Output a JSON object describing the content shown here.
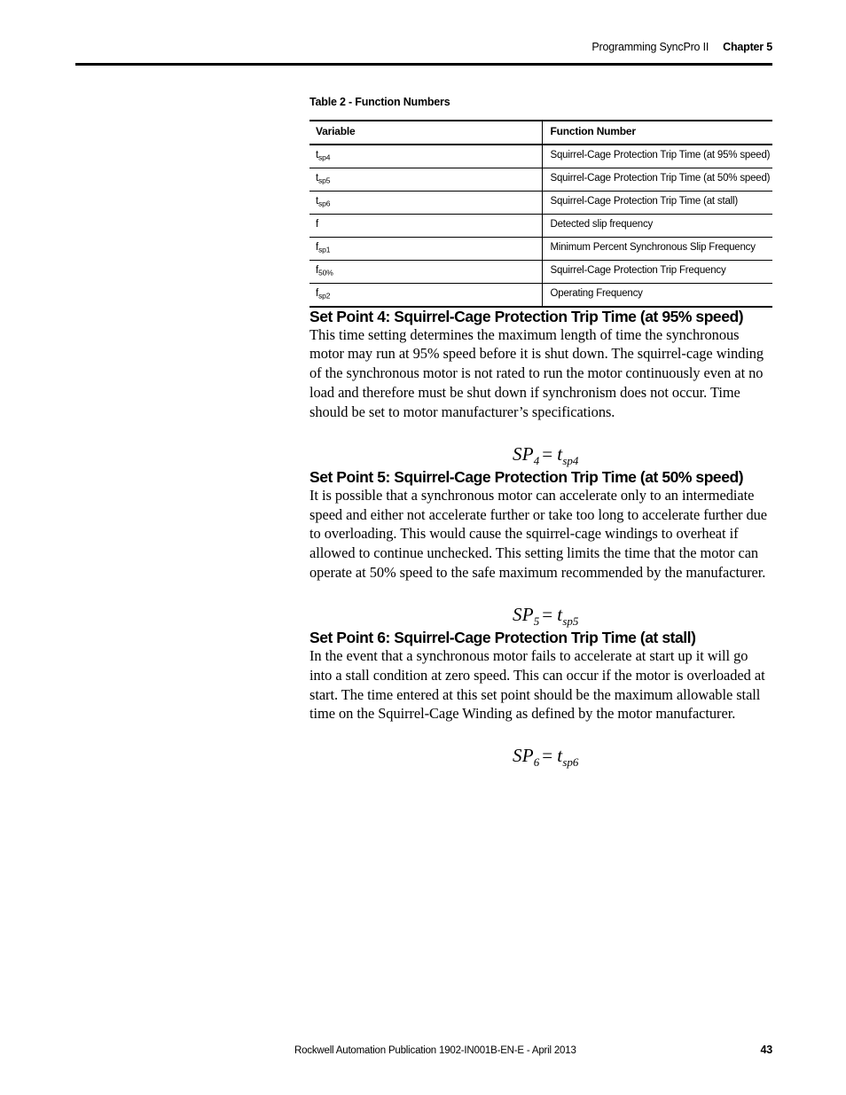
{
  "header": {
    "section_title": "Programming SyncPro II",
    "chapter_label": "Chapter 5"
  },
  "table": {
    "title": "Table 2 - Function Numbers",
    "columns": [
      "Variable",
      "Function Number"
    ],
    "rows": [
      {
        "variable_base": "t",
        "variable_sub": "sp4",
        "function_number": "Squirrel-Cage Protection Trip Time (at 95% speed)"
      },
      {
        "variable_base": "t",
        "variable_sub": "sp5",
        "function_number": "Squirrel-Cage Protection Trip Time (at 50% speed)"
      },
      {
        "variable_base": "t",
        "variable_sub": "sp6",
        "function_number": "Squirrel-Cage Protection Trip Time (at stall)"
      },
      {
        "variable_base": "f",
        "variable_sub": "",
        "function_number": "Detected slip frequency"
      },
      {
        "variable_base": "f",
        "variable_sub": "sp1",
        "function_number": "Minimum Percent Synchronous Slip Frequency"
      },
      {
        "variable_base": "f",
        "variable_sub": "50%",
        "function_number": "Squirrel-Cage Protection Trip Frequency"
      },
      {
        "variable_base": "f",
        "variable_sub": "sp2",
        "function_number": "Operating Frequency"
      }
    ]
  },
  "sections": [
    {
      "heading": "Set Point 4: Squirrel-Cage Protection Trip Time (at 95% speed)",
      "body": "This time setting determines the maximum length of time the synchronous motor may run at 95% speed before it is shut down. The squirrel-cage winding of the synchronous motor is not rated to run the motor continuously even at no load and therefore must be shut down if synchronism does not occur. Time should be set to motor manufacturer’s specifications.",
      "equation": {
        "lhs_base": "SP",
        "lhs_sub": "4",
        "operator": "=",
        "rhs_base": "t",
        "rhs_sub": "sp4"
      }
    },
    {
      "heading": "Set Point 5: Squirrel-Cage Protection Trip Time (at 50% speed)",
      "body": "It is possible that a synchronous motor can accelerate only to an intermediate speed and either not accelerate further or take too long to accelerate further due to overloading. This would cause the squirrel-cage windings to overheat if allowed to continue unchecked. This setting limits the time that the motor can operate at 50% speed to the safe maximum recommended by the manufacturer.",
      "equation": {
        "lhs_base": "SP",
        "lhs_sub": "5",
        "operator": "=",
        "rhs_base": "t",
        "rhs_sub": "sp5"
      }
    },
    {
      "heading": "Set Point 6: Squirrel-Cage Protection Trip Time (at stall)",
      "body": "In the event that a synchronous motor fails to accelerate at start up it will go into a stall condition at zero speed. This can occur if the motor is overloaded at start. The time entered at this set point should be the maximum allowable stall time on the Squirrel-Cage Winding as defined by the motor manufacturer.",
      "equation": {
        "lhs_base": "SP",
        "lhs_sub": "6",
        "operator": "=",
        "rhs_base": "t",
        "rhs_sub": "sp6"
      }
    }
  ],
  "footer": {
    "publication": "Rockwell Automation Publication 1902-IN001B-EN-E - April 2013",
    "page_number": "43"
  }
}
